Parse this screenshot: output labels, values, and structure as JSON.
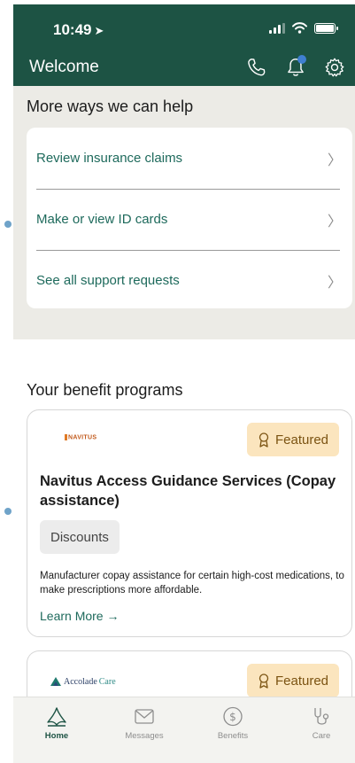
{
  "status_bar": {
    "time": "10:49",
    "location_glyph": "➤"
  },
  "nav": {
    "title": "Welcome",
    "icons": [
      "phone-icon",
      "bell-icon",
      "gear-icon"
    ],
    "color": "#1d5344"
  },
  "help": {
    "title": "More ways we can help",
    "items": [
      {
        "label": "Review insurance claims"
      },
      {
        "label": "Make or view ID cards"
      },
      {
        "label": "See all support requests"
      }
    ]
  },
  "benefits": {
    "title": "Your benefit programs",
    "cards": [
      {
        "logo": "NAVITUS",
        "badge": "Featured",
        "title": "Navitus Access Guidance Services (Copay assistance)",
        "tag": "Discounts",
        "description": "Manufacturer copay assistance for certain high-cost medications, to make prescriptions more affordable.",
        "link": "Learn More →"
      },
      {
        "logo_main": "Accolade",
        "logo_sub": "Care",
        "badge": "Featured"
      }
    ]
  },
  "tabbar": {
    "tabs": [
      {
        "label": "Home",
        "icon": "home-icon",
        "active": true
      },
      {
        "label": "Messages",
        "icon": "envelope-icon",
        "active": false
      },
      {
        "label": "Benefits",
        "icon": "dollar-icon",
        "active": false
      },
      {
        "label": "Care",
        "icon": "stethoscope-icon",
        "active": false
      }
    ]
  },
  "colors": {
    "accent": "#1e6a5c",
    "badge_bg": "#fbe5be",
    "section_bg": "#ecebe6"
  }
}
